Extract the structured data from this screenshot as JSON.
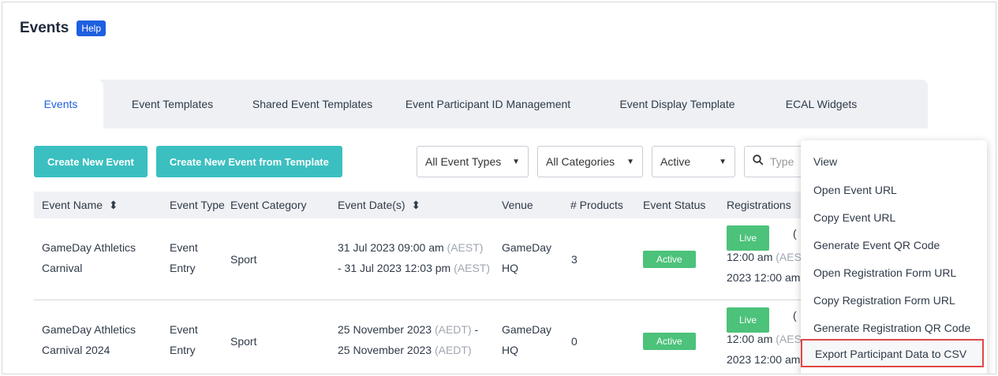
{
  "header": {
    "title": "Events",
    "help_label": "Help"
  },
  "tabs": [
    {
      "label": "Events"
    },
    {
      "label": "Event Templates"
    },
    {
      "label": "Shared Event Templates"
    },
    {
      "label": "Event Participant ID Management"
    },
    {
      "label": "Event Display Template"
    },
    {
      "label": "ECAL Widgets"
    }
  ],
  "toolbar": {
    "create_label": "Create New Event",
    "create_template_label": "Create New Event from Template",
    "type_filter": "All Event Types",
    "category_filter": "All Categories",
    "status_filter": "Active",
    "search_placeholder": "Type"
  },
  "table": {
    "headers": {
      "name": "Event Name",
      "type": "Event Type",
      "category": "Event Category",
      "dates": "Event Date(s)",
      "venue": "Venue",
      "products": "# Products",
      "status": "Event Status",
      "registrations": "Registrations"
    },
    "rows": [
      {
        "name_l1": "GameDay Athletics",
        "name_l2": "Carnival",
        "type_l1": "Event",
        "type_l2": "Entry",
        "category": "Sport",
        "date1": "31 Jul 2023 09:00 am",
        "tz1": "(AEST)",
        "date2": "- 31 Jul 2023 12:03 pm",
        "tz2": "(AEST)",
        "venue_l1": "GameDay",
        "venue_l2": "HQ",
        "products": "3",
        "status": "Active",
        "reg_badge": "Live",
        "reg_paren": "(",
        "reg_l2": "12:00 am",
        "reg_l2_tz": "(AES",
        "reg_l3": "2023 12:00 am"
      },
      {
        "name_l1": "GameDay Athletics",
        "name_l2": "Carnival 2024",
        "type_l1": "Event",
        "type_l2": "Entry",
        "category": "Sport",
        "date1": "25 November 2023",
        "tz1": "(AEDT)",
        "date1_suffix": " -",
        "date2": "25 November 2023",
        "tz2": "(AEDT)",
        "venue_l1": "GameDay",
        "venue_l2": "HQ",
        "products": "0",
        "status": "Active",
        "reg_badge": "Live",
        "reg_paren": "(",
        "reg_l2": "12:00 am",
        "reg_l2_tz": "(AES",
        "reg_l3": "2023 12:00 am"
      }
    ]
  },
  "menu": {
    "items": [
      "View",
      "Open Event URL",
      "Copy Event URL",
      "Generate Event QR Code",
      "Open Registration Form URL",
      "Copy Registration Form URL",
      "Generate Registration QR Code",
      "Export Participant Data to CSV"
    ]
  },
  "icons": {
    "sort": "sort-icon",
    "caret": "chevron-down-icon",
    "search": "search-icon"
  },
  "colors": {
    "brand_blue": "#1f5fe0",
    "teal": "#3bbfc0",
    "active_green": "#4cc27a",
    "highlight_red": "#e04848"
  }
}
